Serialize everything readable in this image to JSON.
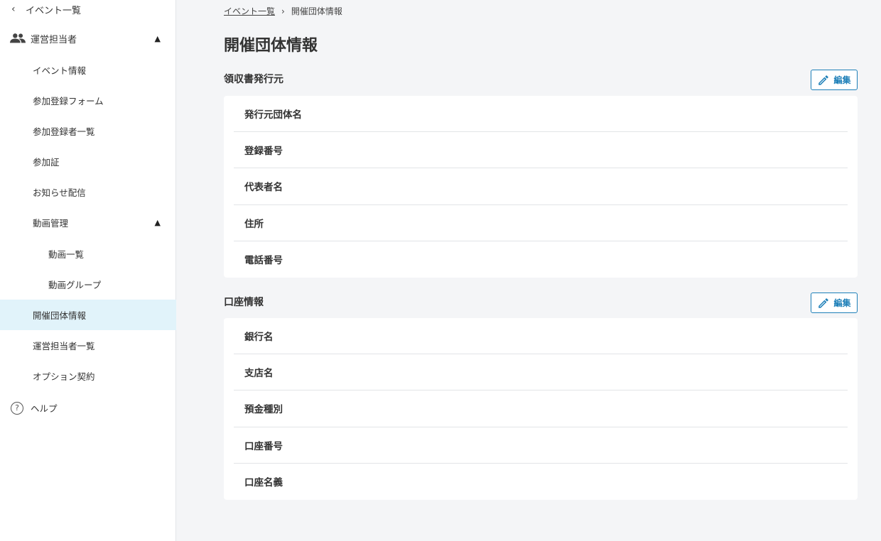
{
  "sidebar": {
    "back_label": "イベント一覧",
    "group_label": "運営担当者",
    "items": [
      {
        "label": "イベント情報"
      },
      {
        "label": "参加登録フォーム"
      },
      {
        "label": "参加登録者一覧"
      },
      {
        "label": "参加証"
      },
      {
        "label": "お知らせ配信"
      },
      {
        "label": "動画管理"
      }
    ],
    "sub_items": [
      {
        "label": "動画一覧"
      },
      {
        "label": "動画グループ"
      }
    ],
    "items_after": [
      {
        "label": "開催団体情報",
        "active": true
      },
      {
        "label": "運営担当者一覧"
      },
      {
        "label": "オプション契約"
      }
    ],
    "help_label": "ヘルプ",
    "active_color": "#e1f3fa"
  },
  "breadcrumb": {
    "link": "イベント一覧",
    "current": "開催団体情報"
  },
  "page_title": "開催団体情報",
  "sections": [
    {
      "title": "領収書発行元",
      "edit_label": "編集",
      "fields": [
        "発行元団体名",
        "登録番号",
        "代表者名",
        "住所",
        "電話番号"
      ]
    },
    {
      "title": "口座情報",
      "edit_label": "編集",
      "fields": [
        "銀行名",
        "支店名",
        "預金種別",
        "口座番号",
        "口座名義"
      ]
    }
  ],
  "accent_color": "#1d7fb8"
}
